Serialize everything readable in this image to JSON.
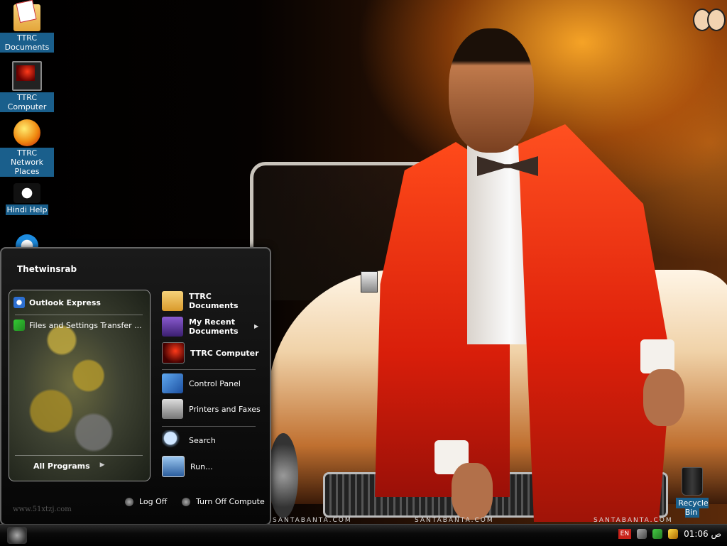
{
  "desktop": {
    "icons": [
      {
        "label": "TTRC Documents",
        "icon": "folder-icon"
      },
      {
        "label": "TTRC Computer",
        "icon": "computer-icon"
      },
      {
        "label": "TTRC Network Places",
        "icon": "network-globe-icon"
      },
      {
        "label": "Hindi Help",
        "icon": "help-logo-icon"
      },
      {
        "label": "",
        "icon": "app-shortcut-icon"
      }
    ],
    "recycle_bin_label": "Recycle Bin",
    "watermarks": [
      "SANTABANTA.COM",
      "SANTABANTA.COM",
      "SANTABANTA.COM"
    ]
  },
  "start_menu": {
    "user_name": "Thetwinsrab",
    "pinned": [
      {
        "label": "Outlook Express",
        "icon": "outlook-express-icon"
      }
    ],
    "recent_programs": [
      {
        "label": "Files and Settings Transfer ...",
        "icon": "transfer-wizard-icon"
      }
    ],
    "all_programs_label": "All Programs",
    "places": [
      {
        "label_line1": "TTRC",
        "label_line2": "Documents",
        "icon": "documents-folder-icon"
      },
      {
        "label_line1": "My Recent",
        "label_line2": "Documents",
        "icon": "recent-documents-icon"
      },
      {
        "label_line1": "TTRC Computer",
        "label_line2": "",
        "icon": "computer-icon"
      }
    ],
    "system_links": [
      {
        "label": "Control Panel",
        "icon": "control-panel-icon"
      },
      {
        "label": "Printers and Faxes",
        "icon": "printer-icon"
      },
      {
        "label": "Search",
        "icon": "search-icon"
      },
      {
        "label": "Run...",
        "icon": "run-icon"
      }
    ],
    "footer": {
      "watermark": "www.51xtzj.com",
      "log_off_label": "Log Off",
      "turn_off_label": "Turn Off Compute"
    }
  },
  "taskbar": {
    "language": "EN",
    "clock": "01:06",
    "clock_suffix": "ص"
  }
}
